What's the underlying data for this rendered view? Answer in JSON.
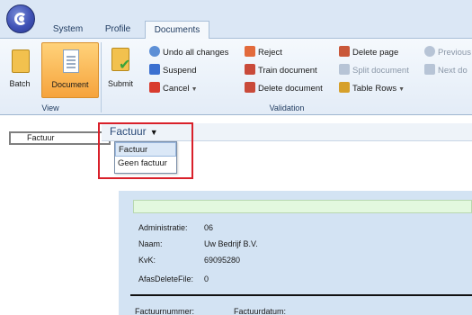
{
  "tabs": {
    "system": "System",
    "profile": "Profile",
    "documents": "Documents"
  },
  "ribbon": {
    "view_group": {
      "label": "View",
      "batch": "Batch",
      "document": "Document"
    },
    "validation_group": {
      "label": "Validation",
      "submit": "Submit",
      "undo_all": "Undo all changes",
      "suspend": "Suspend",
      "cancel": "Cancel",
      "reject": "Reject",
      "train_document": "Train document",
      "delete_document": "Delete document",
      "delete_page": "Delete page",
      "split_document": "Split document",
      "table_rows": "Table Rows",
      "previous": "Previous",
      "next": "Next do"
    }
  },
  "left_pane": {
    "selected_type": "Factuur"
  },
  "document_type": {
    "title": "Factuur",
    "options": [
      "Factuur",
      "Geen factuur"
    ],
    "selected": "Factuur"
  },
  "form": {
    "administratie": {
      "label": "Administratie:",
      "value": "06"
    },
    "naam": {
      "label": "Naam:",
      "value": "Uw Bedrijf B.V."
    },
    "kvk": {
      "label": "KvK:",
      "value": "69095280"
    },
    "afas": {
      "label": "AfasDeleteFile:",
      "value": "0"
    },
    "factuurnummer": {
      "label": "Factuurnummer:"
    },
    "factuurdatum": {
      "label": "Factuurdatum:"
    }
  },
  "colors": {
    "accent_active": "#f6a33c",
    "highlight_box": "#d9202a",
    "panel_bg": "#d3e3f3"
  }
}
